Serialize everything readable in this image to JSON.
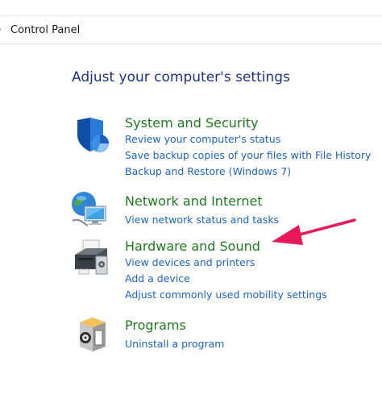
{
  "breadcrumb": {
    "chevron": "›",
    "current": "Control Panel"
  },
  "page_title": "Adjust your computer's settings",
  "categories": [
    {
      "title": "System and Security",
      "icon": "shield-icon",
      "links": [
        "Review your computer's status",
        "Save backup copies of your files with File History",
        "Backup and Restore (Windows 7)"
      ]
    },
    {
      "title": "Network and Internet",
      "icon": "network-globe-icon",
      "links": [
        "View network status and tasks"
      ]
    },
    {
      "title": "Hardware and Sound",
      "icon": "printer-icon",
      "links": [
        "View devices and printers",
        "Add a device",
        "Adjust commonly used mobility settings"
      ]
    },
    {
      "title": "Programs",
      "icon": "programs-box-icon",
      "links": [
        "Uninstall a program"
      ]
    }
  ],
  "annotation": {
    "arrow_color": "#e8195a",
    "arrow_icon": "pointer-arrow"
  }
}
